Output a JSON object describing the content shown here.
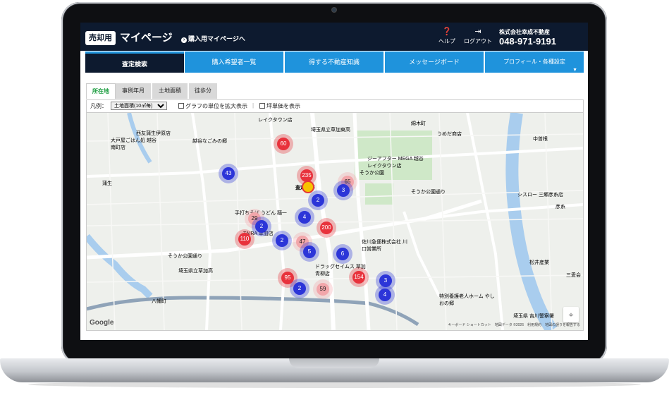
{
  "header": {
    "badge": "売却用",
    "title": "マイページ",
    "buy_link": "購入用マイページへ",
    "help": "ヘルプ",
    "logout": "ログアウト",
    "company": "株式会社幸成不動産",
    "phone": "048-971-9191"
  },
  "nav": {
    "tabs": [
      "査定検索",
      "購入希望者一覧",
      "得する不動産知識",
      "メッセージボード",
      "プロフィール・各種設定"
    ],
    "active": "査定検索"
  },
  "subtabs": [
    "所在地",
    "事例年月",
    "土地面積",
    "徒歩分"
  ],
  "filter": {
    "legend_label": "凡例：",
    "select_value": "土地面積(10㎡毎)",
    "check1": "グラフの単位を拡大表示",
    "check2": "坪単価を表示"
  },
  "map": {
    "labels": [
      {
        "text": "レイクタウン店",
        "color": "#d9534f"
      },
      {
        "text": "綿木町",
        "color": "#333"
      },
      {
        "text": "西友蒲生伊原店",
        "color": "#1e7ab8"
      },
      {
        "text": "越谷なごみの郷",
        "color": "#555"
      },
      {
        "text": "埼玉県立草加東高",
        "color": "#555"
      },
      {
        "text": "うめだ商店",
        "color": "#d35400"
      },
      {
        "text": "中曽根",
        "color": "#333"
      },
      {
        "text": "大戸屋ごはん処 越谷南町店",
        "color": "#d35400"
      },
      {
        "text": "ジーアフター MEGA 越谷レイクタウン店",
        "color": "#1a9c7a"
      },
      {
        "text": "そうか公園",
        "color": "#2e7d32"
      },
      {
        "text": "蒲生",
        "color": "#333"
      },
      {
        "text": "そうか公園通り",
        "color": "#555"
      },
      {
        "text": "シスロー 三郷彦糸店",
        "color": "#d9534f"
      },
      {
        "text": "彦糸",
        "color": "#333"
      },
      {
        "text": "手打ちそば うどん 麺一",
        "color": "#d35400"
      },
      {
        "text": "TAIRA 草加店",
        "color": "#1e7ab8"
      },
      {
        "text": "佐川急便株式会社 川口営業所",
        "color": "#555"
      },
      {
        "text": "松井産業",
        "color": "#1e7ab8"
      },
      {
        "text": "そうか公園通り",
        "color": "#555"
      },
      {
        "text": "ドラッグセイムス 草加青柳店",
        "color": "#1e7ab8"
      },
      {
        "text": "三愛会",
        "color": "#d9534f"
      },
      {
        "text": "埼玉県立草加高",
        "color": "#555"
      },
      {
        "text": "八幡町",
        "color": "#333"
      },
      {
        "text": "特別養護老人ホーム やしおの郷",
        "color": "#555"
      },
      {
        "text": "埼玉県 吉川警察署",
        "color": "#555"
      },
      {
        "text": "査定物件",
        "color": "#c0392b"
      }
    ],
    "clusters": [
      {
        "v": "60",
        "c": "red"
      },
      {
        "v": "43",
        "c": "blue"
      },
      {
        "v": "235",
        "c": "red"
      },
      {
        "v": "65",
        "c": "pink"
      },
      {
        "v": "3",
        "c": "blue"
      },
      {
        "v": "2",
        "c": "blue"
      },
      {
        "v": "4",
        "c": "blue"
      },
      {
        "v": "29",
        "c": "pink"
      },
      {
        "v": "2",
        "c": "blue"
      },
      {
        "v": "200",
        "c": "red"
      },
      {
        "v": "110",
        "c": "red"
      },
      {
        "v": "2",
        "c": "blue"
      },
      {
        "v": "47",
        "c": "pink"
      },
      {
        "v": "5",
        "c": "blue"
      },
      {
        "v": "6",
        "c": "blue"
      },
      {
        "v": "95",
        "c": "red"
      },
      {
        "v": "154",
        "c": "red"
      },
      {
        "v": "2",
        "c": "blue"
      },
      {
        "v": "59",
        "c": "pink"
      },
      {
        "v": "3",
        "c": "blue"
      },
      {
        "v": "4",
        "c": "blue"
      }
    ],
    "google": "Google",
    "attribution": "キーボード ショートカット　地図データ ©2026　利用規約　地図の誤りを報告する",
    "colors": {
      "red": "#e8323c",
      "blue": "#2c35d8",
      "pink": "#f2a6aa"
    }
  }
}
